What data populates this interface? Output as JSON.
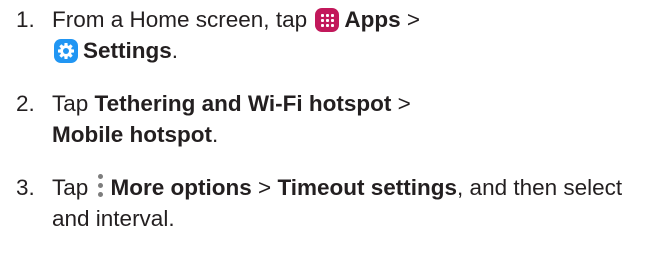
{
  "colors": {
    "text": "#231f20",
    "apps_icon": "#c2185b",
    "settings_icon": "#2196f3",
    "more_icon": "#7d7d7d"
  },
  "icons": [
    "apps-icon",
    "settings-icon",
    "more-options-icon"
  ],
  "steps": [
    {
      "number": "1.",
      "t1": "From a Home screen, tap ",
      "b1": "Apps",
      "t2": " > ",
      "b2": "Settings",
      "t3": "."
    },
    {
      "number": "2.",
      "t1": "Tap ",
      "b1": "Tethering and Wi-Fi hotspot",
      "t2": " > ",
      "b2": "Mobile hotspot",
      "t3": "."
    },
    {
      "number": "3.",
      "t1": "Tap ",
      "b1": "More options",
      "t2": " > ",
      "b2": "Timeout settings",
      "t3": ", and then select and interval."
    }
  ]
}
